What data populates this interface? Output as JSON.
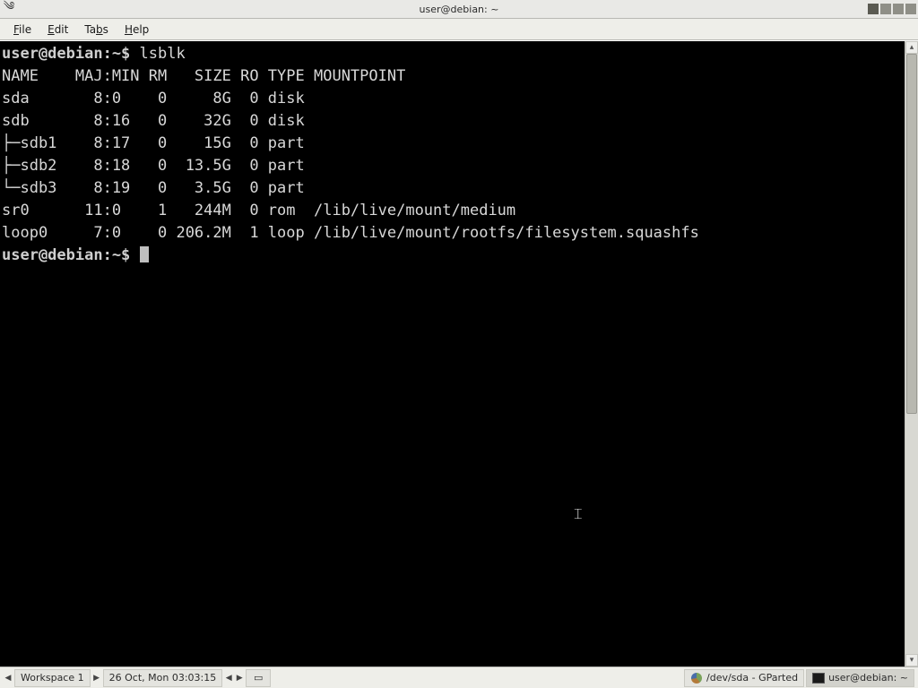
{
  "top_panel": {
    "title": "user@debian: ~"
  },
  "menu": {
    "file": "File",
    "edit": "Edit",
    "tabs": "Tabs",
    "help": "Help"
  },
  "terminal": {
    "prompt": "user@debian:~$",
    "command": "lsblk",
    "header": "NAME    MAJ:MIN RM   SIZE RO TYPE MOUNTPOINT",
    "rows": [
      "sda       8:0    0     8G  0 disk ",
      "sdb       8:16   0    32G  0 disk ",
      "├─sdb1    8:17   0    15G  0 part ",
      "├─sdb2    8:18   0  13.5G  0 part ",
      "└─sdb3    8:19   0   3.5G  0 part ",
      "sr0      11:0    1   244M  0 rom  /lib/live/mount/medium",
      "loop0     7:0    0 206.2M  1 loop /lib/live/mount/rootfs/filesystem.squashfs"
    ]
  },
  "taskbar": {
    "workspace": "Workspace 1",
    "clock": "26 Oct, Mon 03:03:15",
    "task_gparted": "/dev/sda - GParted",
    "task_term": "user@debian: ~"
  }
}
